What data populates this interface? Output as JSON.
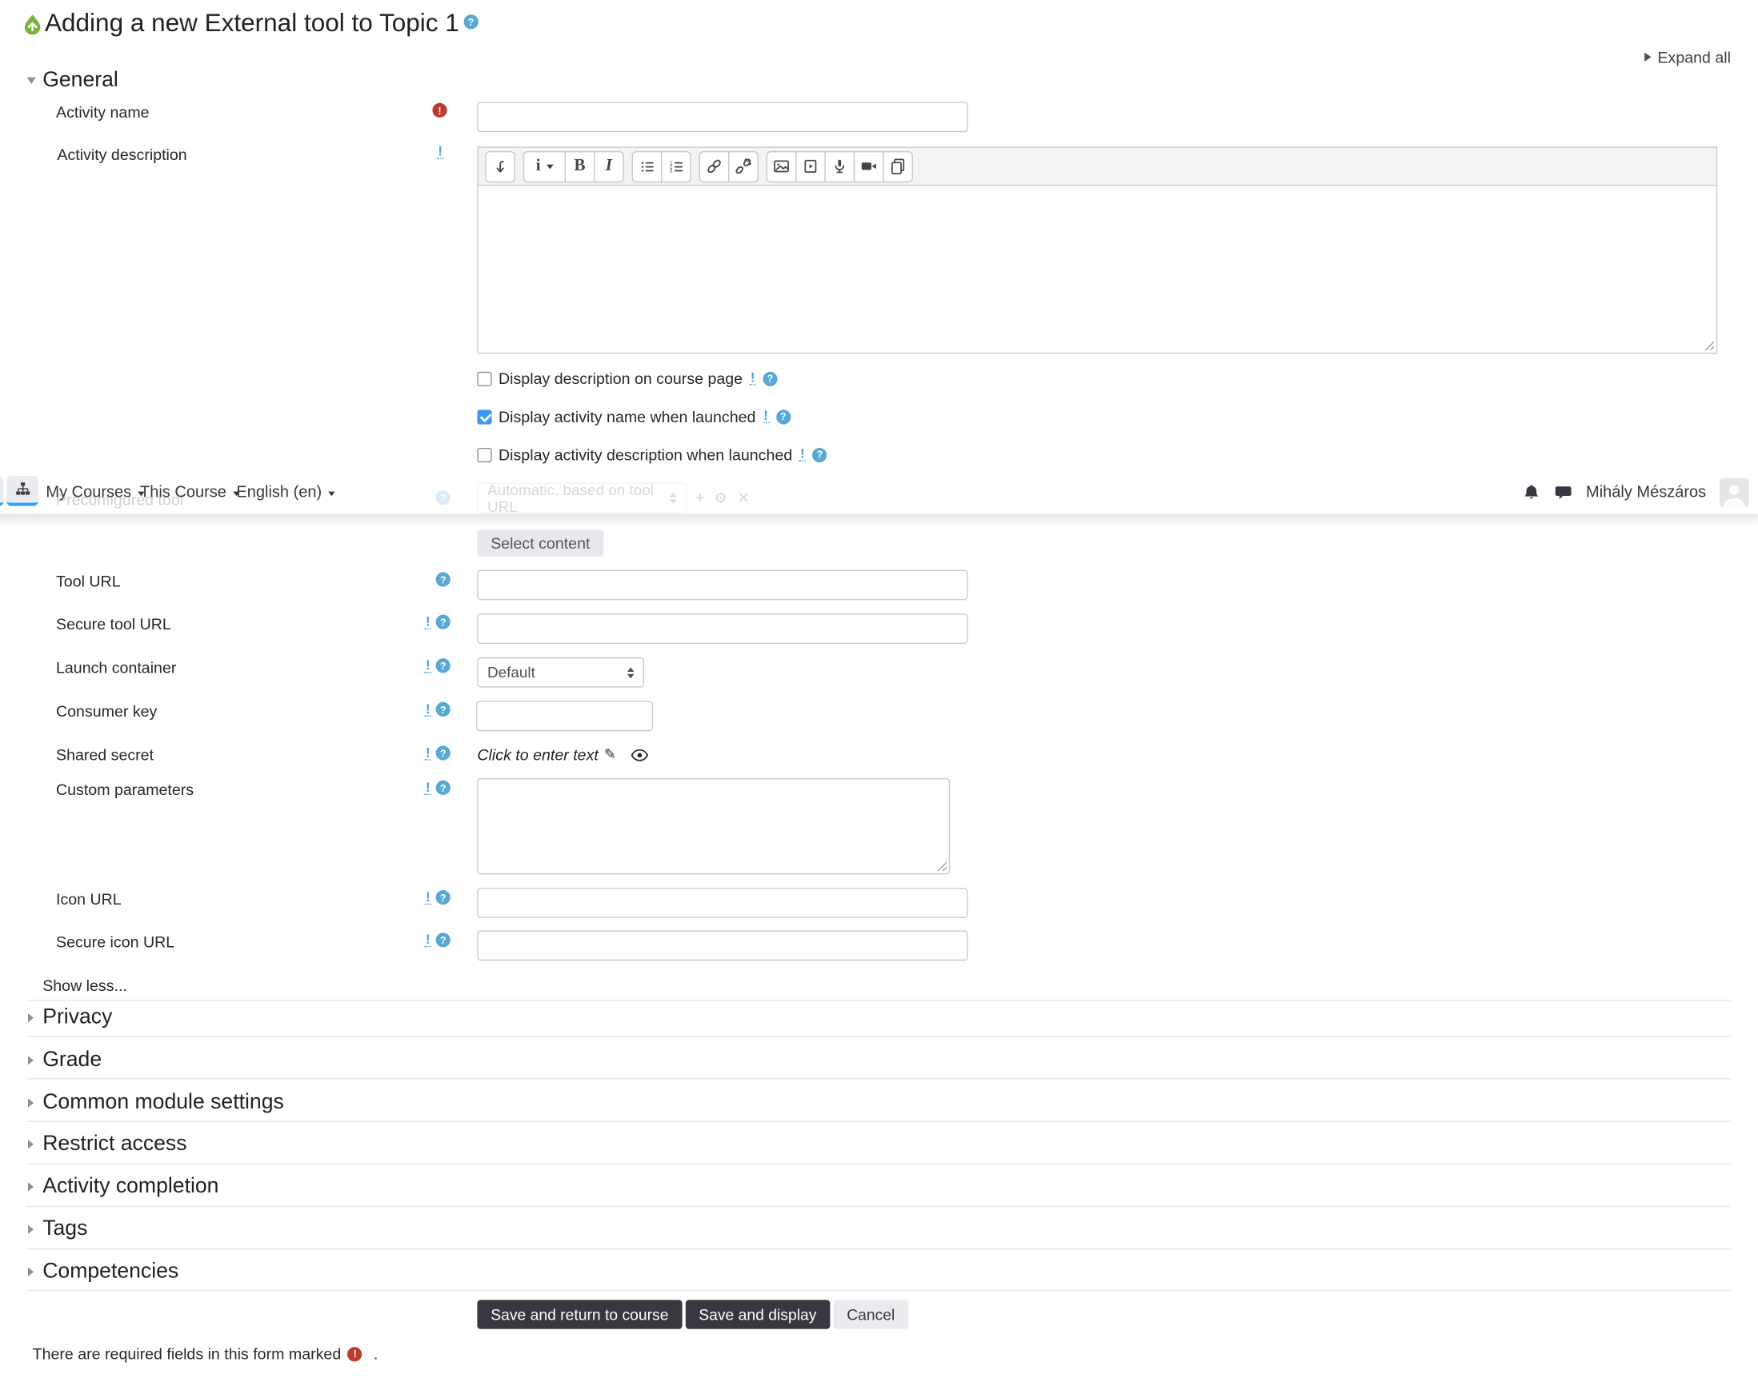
{
  "header": {
    "title": "Adding a new External tool to Topic 1",
    "expand_all": "Expand all"
  },
  "navbar": {
    "items": [
      "My Courses",
      "This Course",
      "English (en)"
    ],
    "user_name": "Mihály Mészáros"
  },
  "icons": {
    "help": "?",
    "required": "!",
    "advanced": "!",
    "plus": "+",
    "gear": "⚙",
    "close": "✕",
    "pencil": "✎",
    "bold": "B",
    "italic": "I",
    "style": "i"
  },
  "form": {
    "general_heading": "General",
    "activity_name": {
      "label": "Activity name",
      "value": ""
    },
    "activity_description": {
      "label": "Activity description",
      "value": ""
    },
    "checkboxes": [
      {
        "label": "Display description on course page",
        "checked": false
      },
      {
        "label": "Display activity name when launched",
        "checked": true
      },
      {
        "label": "Display activity description when launched",
        "checked": false
      }
    ],
    "preconfigured_tool": {
      "label": "Preconfigured tool",
      "value": "Automatic, based on tool URL"
    },
    "select_content": "Select content",
    "tool_url": {
      "label": "Tool URL",
      "value": ""
    },
    "secure_tool_url": {
      "label": "Secure tool URL",
      "value": ""
    },
    "launch_container": {
      "label": "Launch container",
      "value": "Default"
    },
    "consumer_key": {
      "label": "Consumer key",
      "value": ""
    },
    "shared_secret": {
      "label": "Shared secret",
      "value": "Click to enter text"
    },
    "custom_parameters": {
      "label": "Custom parameters",
      "value": ""
    },
    "icon_url": {
      "label": "Icon URL",
      "value": ""
    },
    "secure_icon_url": {
      "label": "Secure icon URL",
      "value": ""
    },
    "show_less": "Show less..."
  },
  "sections": [
    "Privacy",
    "Grade",
    "Common module settings",
    "Restrict access",
    "Activity completion",
    "Tags",
    "Competencies"
  ],
  "buttons": {
    "save_return": "Save and return to course",
    "save_display": "Save and display",
    "cancel": "Cancel"
  },
  "footer": {
    "required_note": "There are required fields in this form marked",
    "required_note_suffix": "."
  },
  "colors": {
    "accent_blue": "#2f9ff7",
    "help_blue": "#57a8d5",
    "required_red": "#bd3a2e",
    "checkbox_checked": "#3f97f9",
    "dark_button": "#343a40"
  }
}
